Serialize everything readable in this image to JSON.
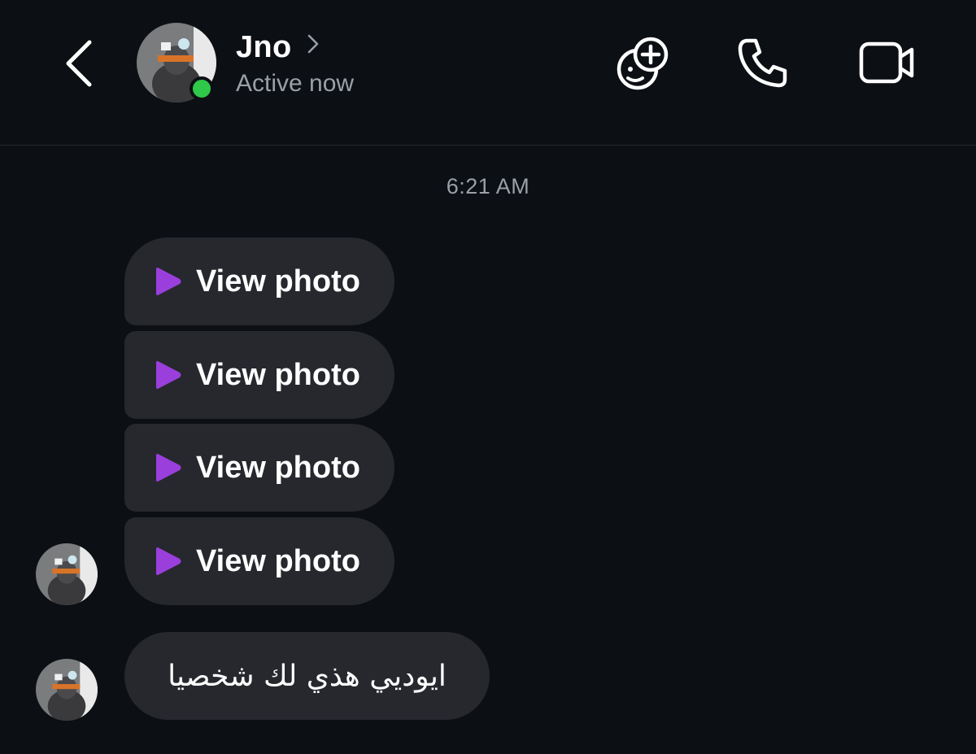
{
  "header": {
    "contact_name": "Jno",
    "status": "Active now",
    "icons": {
      "back": "chevron-left-icon",
      "profile": "chevron-right-icon",
      "effects": "face-plus-icon",
      "call": "phone-icon",
      "video": "video-camera-icon"
    },
    "online_color": "#2fc84a"
  },
  "conversation": {
    "timestamp": "6:21 AM",
    "messages": [
      {
        "type": "photo",
        "label": "View photo"
      },
      {
        "type": "photo",
        "label": "View photo"
      },
      {
        "type": "photo",
        "label": "View photo"
      },
      {
        "type": "photo",
        "label": "View photo"
      },
      {
        "type": "text",
        "text": "ايوديي هذي لك شخصيا"
      }
    ]
  },
  "colors": {
    "background": "#0c0f14",
    "bubble": "#26282e",
    "play_accent": "#9b3fdc",
    "muted_text": "#9aa0a8"
  }
}
